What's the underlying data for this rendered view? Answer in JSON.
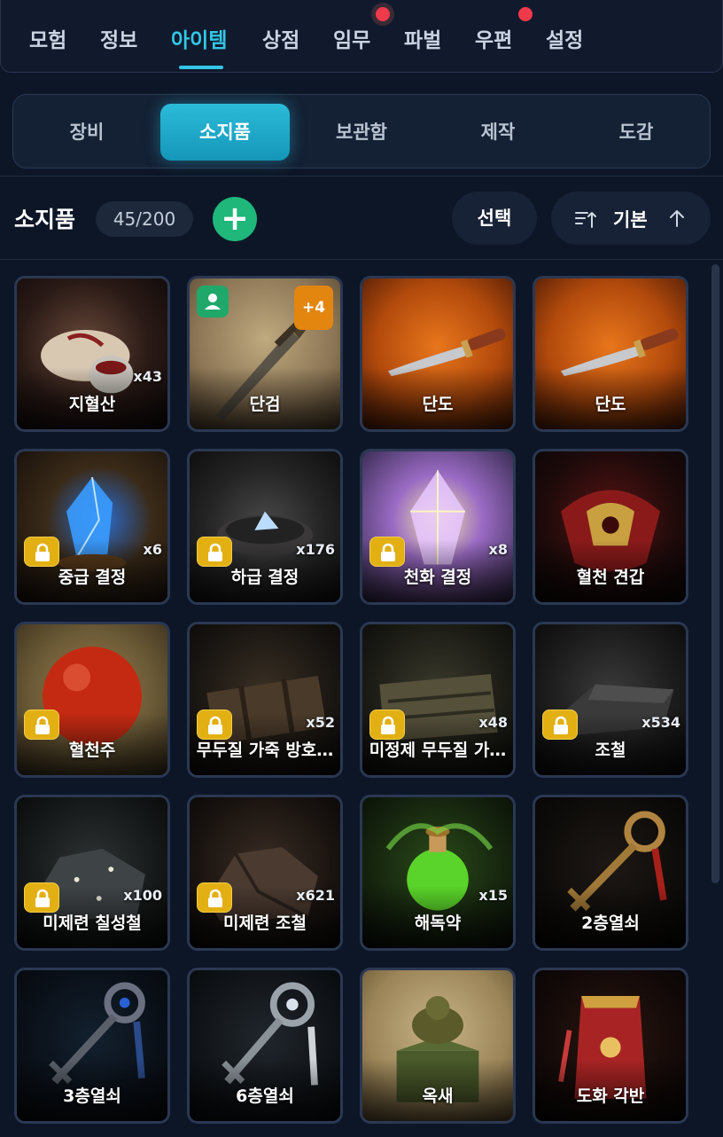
{
  "nav": {
    "tabs": [
      {
        "label": "모험"
      },
      {
        "label": "정보"
      },
      {
        "label": "아이템"
      },
      {
        "label": "상점"
      },
      {
        "label": "임무"
      },
      {
        "label": "파벌"
      },
      {
        "label": "우편"
      },
      {
        "label": "설정"
      }
    ],
    "active_tab": "아이템"
  },
  "subtabs": [
    {
      "label": "장비"
    },
    {
      "label": "소지품"
    },
    {
      "label": "보관함"
    },
    {
      "label": "제작"
    },
    {
      "label": "도감"
    }
  ],
  "inventory": {
    "title": "소지품",
    "count": "45/200",
    "add_label": "+",
    "select_label": "선택",
    "sort_label": "기본"
  },
  "items": [
    {
      "name": "지혈산",
      "qty": "x43",
      "locked": false
    },
    {
      "name": "단검",
      "qty": "",
      "locked": false,
      "enhance": "+4",
      "equipped": true
    },
    {
      "name": "단도",
      "qty": "",
      "locked": false
    },
    {
      "name": "단도",
      "qty": "",
      "locked": false
    },
    {
      "name": "중급 결정",
      "qty": "x6",
      "locked": true
    },
    {
      "name": "하급 결정",
      "qty": "x176",
      "locked": true
    },
    {
      "name": "천화 결정",
      "qty": "x8",
      "locked": true
    },
    {
      "name": "혈천 견갑",
      "qty": "",
      "locked": false
    },
    {
      "name": "혈천주",
      "qty": "",
      "locked": true
    },
    {
      "name": "무두질 가죽 방호…",
      "qty": "x52",
      "locked": true
    },
    {
      "name": "미정제 무두질 가…",
      "qty": "x48",
      "locked": true
    },
    {
      "name": "조철",
      "qty": "x534",
      "locked": true
    },
    {
      "name": "미제련 칠성철",
      "qty": "x100",
      "locked": true
    },
    {
      "name": "미제련 조철",
      "qty": "x621",
      "locked": true
    },
    {
      "name": "해독약",
      "qty": "x15",
      "locked": false
    },
    {
      "name": "2층열쇠",
      "qty": "",
      "locked": false
    },
    {
      "name": "3층열쇠",
      "qty": "",
      "locked": false
    },
    {
      "name": "6층열쇠",
      "qty": "",
      "locked": false
    },
    {
      "name": "옥새",
      "qty": "",
      "locked": false
    },
    {
      "name": "도화 각반",
      "qty": "",
      "locked": false
    }
  ],
  "colors": {
    "accent": "#34c6e6",
    "add_button": "#1fb77a",
    "lock_badge": "#e2b013",
    "enhance_badge": "#e2860f",
    "notification_dot": "#ee3a4a"
  }
}
